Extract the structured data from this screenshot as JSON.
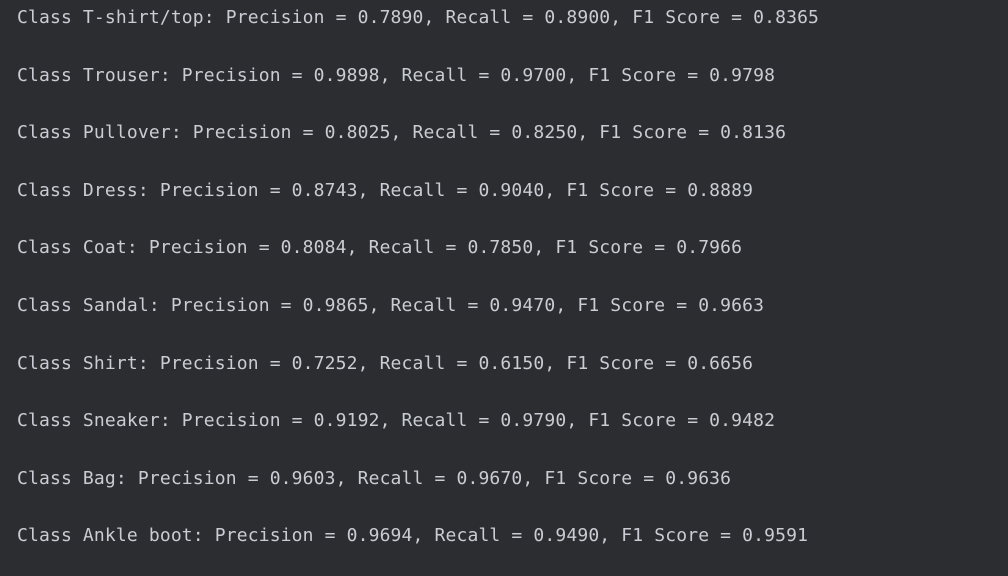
{
  "output": {
    "lines": [
      "Class T-shirt/top: Precision = 0.7890, Recall = 0.8900, F1 Score = 0.8365",
      "Class Trouser: Precision = 0.9898, Recall = 0.9700, F1 Score = 0.9798",
      "Class Pullover: Precision = 0.8025, Recall = 0.8250, F1 Score = 0.8136",
      "Class Dress: Precision = 0.8743, Recall = 0.9040, F1 Score = 0.8889",
      "Class Coat: Precision = 0.8084, Recall = 0.7850, F1 Score = 0.7966",
      "Class Sandal: Precision = 0.9865, Recall = 0.9470, F1 Score = 0.9663",
      "Class Shirt: Precision = 0.7252, Recall = 0.6150, F1 Score = 0.6656",
      "Class Sneaker: Precision = 0.9192, Recall = 0.9790, F1 Score = 0.9482",
      "Class Bag: Precision = 0.9603, Recall = 0.9670, F1 Score = 0.9636",
      "Class Ankle boot: Precision = 0.9694, Recall = 0.9490, F1 Score = 0.9591"
    ]
  }
}
